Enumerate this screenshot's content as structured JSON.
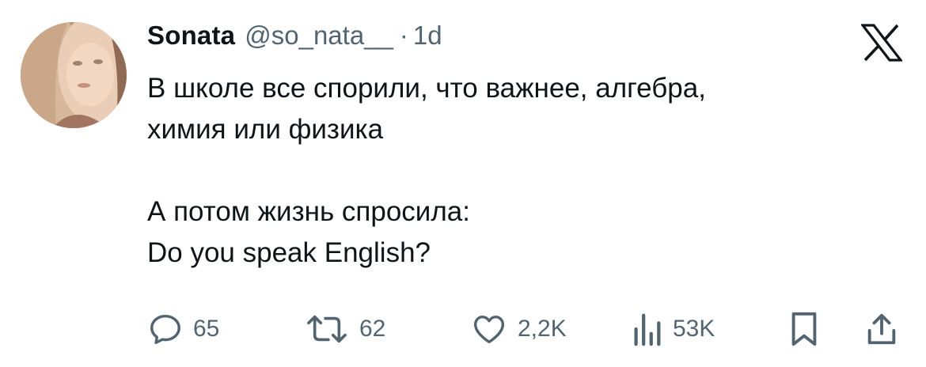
{
  "tweet": {
    "author": {
      "display_name": "Sonata",
      "handle": "@so_nata__",
      "separator": "·",
      "time": "1d"
    },
    "text": "В школе все спорили, что важнее, алгебра,\nхимия или физика\n\nА потом жизнь спросила:\nDo you speak English?",
    "actions": {
      "replies": "65",
      "reposts": "62",
      "likes": "2,2K",
      "views": "53K"
    }
  },
  "icons": {
    "logo": "x-logo-icon",
    "reply": "reply-icon",
    "repost": "repost-icon",
    "like": "heart-icon",
    "views": "views-icon",
    "bookmark": "bookmark-icon",
    "share": "share-icon"
  },
  "colors": {
    "text_primary": "#0f1419",
    "text_secondary": "#536471",
    "background": "#ffffff"
  }
}
